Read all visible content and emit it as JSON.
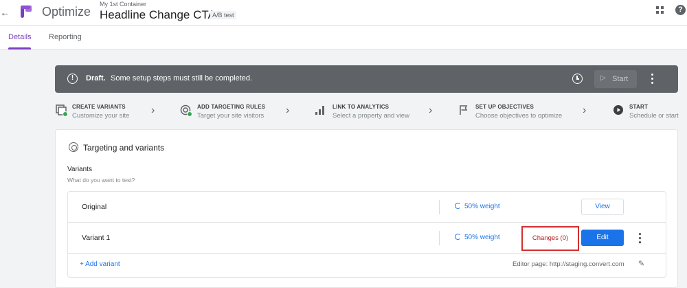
{
  "header": {
    "back_icon": "arrow-left-icon",
    "app_name": "Optimize",
    "container_name": "My 1st Container",
    "experiment_title": "Headline Change CTA",
    "experiment_type": "A/B test",
    "apps_icon": "grid-apps-icon",
    "help_label": "?"
  },
  "tabs": [
    {
      "label": "Details",
      "active": true
    },
    {
      "label": "Reporting",
      "active": false
    }
  ],
  "banner": {
    "info_glyph": "!",
    "status": "Draft.",
    "message": "Some setup steps must still be completed.",
    "start_label": "Start",
    "play_glyph": "▷"
  },
  "steps": [
    {
      "title": "CREATE VARIANTS",
      "subtitle": "Customize your site",
      "icon": "variants-icon",
      "done": true
    },
    {
      "title": "ADD TARGETING RULES",
      "subtitle": "Target your site visitors",
      "icon": "targeting-icon",
      "done": true
    },
    {
      "title": "LINK TO ANALYTICS",
      "subtitle": "Select a property and view",
      "icon": "analytics-icon",
      "done": false
    },
    {
      "title": "SET UP OBJECTIVES",
      "subtitle": "Choose objectives to optimize",
      "icon": "flag-icon",
      "done": false
    },
    {
      "title": "START",
      "subtitle": "Schedule or start",
      "icon": "play-circle-icon",
      "done": false
    }
  ],
  "step_chevron": "›",
  "card": {
    "title": "Targeting and variants",
    "variants_heading": "Variants",
    "variants_subtitle": "What do you want to test?",
    "rows": [
      {
        "name": "Original",
        "weight": "50% weight",
        "action": "View"
      },
      {
        "name": "Variant 1",
        "weight": "50% weight",
        "changes": "Changes (0)",
        "action": "Edit"
      }
    ],
    "add_variant": "+ Add variant",
    "editor_page": "Editor page: http://staging.convert.com",
    "pencil_glyph": "✎"
  },
  "colors": {
    "accent_purple": "#7b3fbf",
    "primary_blue": "#1a73e8",
    "banner_gray": "#5f6368",
    "highlight_red": "#d32f2f",
    "success_green": "#34a853"
  }
}
